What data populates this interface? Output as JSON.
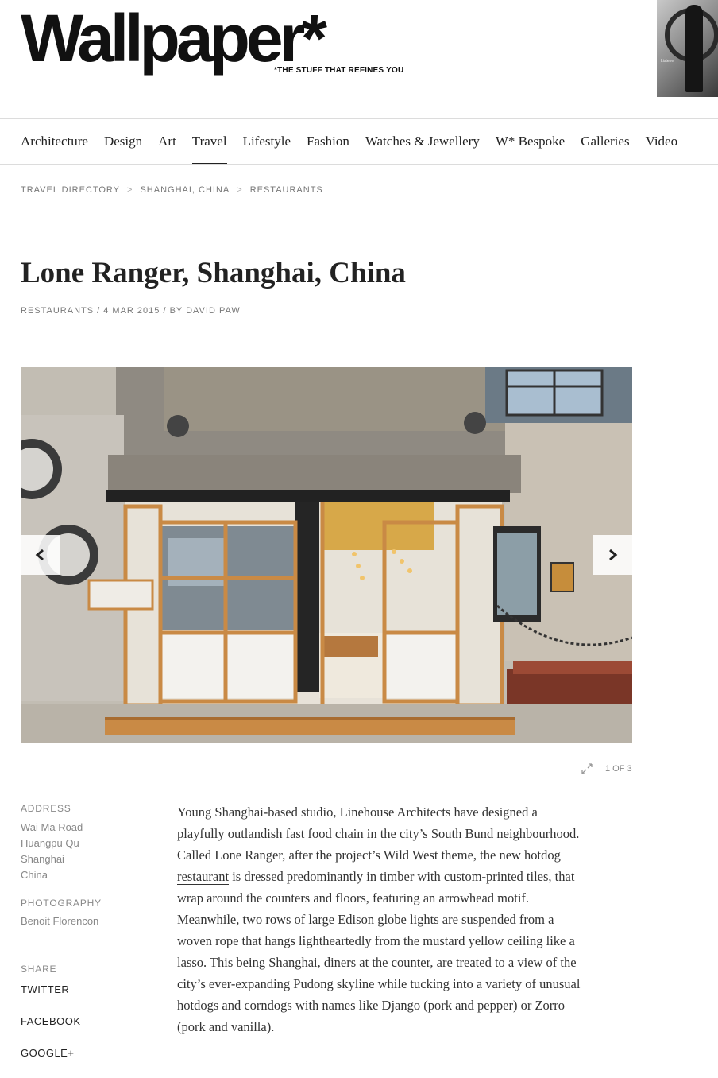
{
  "header": {
    "logo": "Wallpaper*",
    "tagline": "*THE STUFF THAT REFINES YOU",
    "cover_text": "Listener"
  },
  "nav": {
    "items": [
      "Architecture",
      "Design",
      "Art",
      "Travel",
      "Lifestyle",
      "Fashion",
      "Watches & Jewellery",
      "W* Bespoke",
      "Galleries",
      "Video"
    ],
    "active": "Travel"
  },
  "breadcrumb": {
    "items": [
      "TRAVEL DIRECTORY",
      "SHANGHAI, CHINA",
      "RESTAURANTS"
    ],
    "separator": ">"
  },
  "article": {
    "title": "Lone Ranger, Shanghai, China",
    "meta": "RESTAURANTS / 4 MAR 2015 / BY DAVID PAW",
    "gallery_counter": "1 OF 3",
    "body_before": "Young Shanghai-based studio, Linehouse Architects have designed a playfully outlandish fast food chain in the city’s South Bund neighbourhood. Called Lone Ranger, after the project’s Wild West theme, the new hotdog ",
    "body_link": "restaurant",
    "body_after": " is dressed predominantly in timber with custom-printed tiles, that wrap around the counters and floors, featuring an arrowhead motif. Meanwhile, two rows of large Edison globe lights are suspended from a woven rope that hangs lightheartedly from the mustard yellow ceiling like a lasso. This being Shanghai, diners at the counter, are treated to a view of the city’s ever-expanding Pudong skyline while tucking into a variety of unusual hotdogs and corndogs with names like Django (pork and pepper) or Zorro (pork and vanilla)."
  },
  "sidebar": {
    "address_label": "ADDRESS",
    "address_lines": [
      "Wai Ma Road",
      "Huangpu Qu",
      "Shanghai",
      "China"
    ],
    "photography_label": "PHOTOGRAPHY",
    "photographer": "Benoit Florencon",
    "share_label": "SHARE",
    "share_links": [
      "TWITTER",
      "FACEBOOK",
      "GOOGLE+"
    ]
  },
  "colors": {
    "text": "#222222",
    "muted": "#888888",
    "divider": "#dcdcdc",
    "timber": "#c98a45",
    "wall": "#b8b2a7"
  },
  "icons": [
    "chevron-left-icon",
    "chevron-right-icon",
    "expand-icon"
  ]
}
